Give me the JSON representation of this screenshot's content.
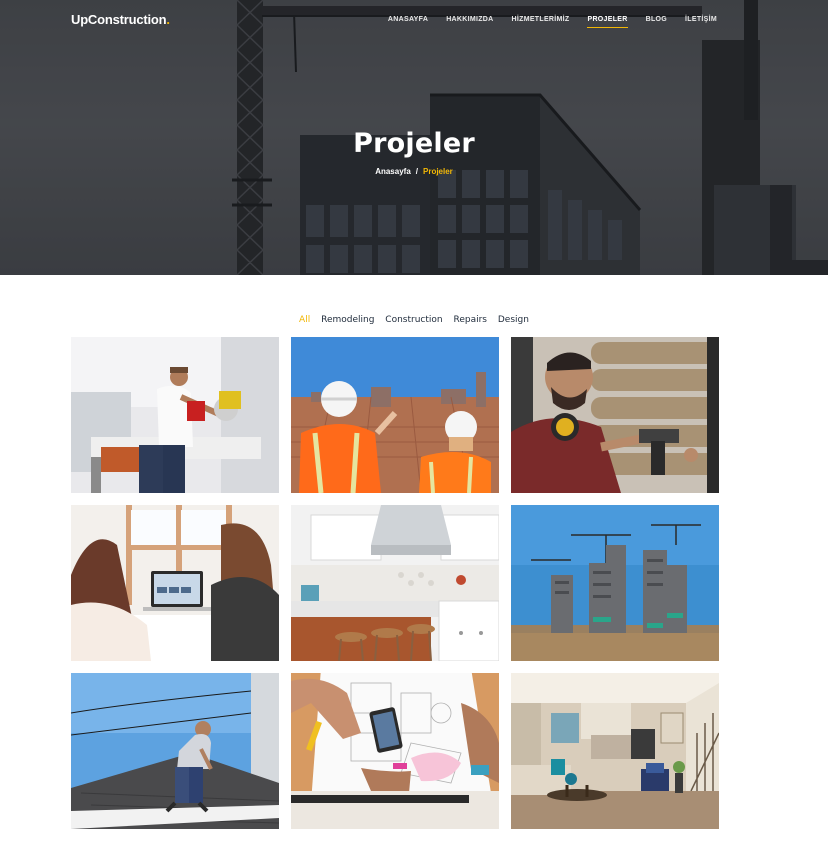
{
  "brand": {
    "name": "UpConstruction",
    "dot": "."
  },
  "nav": {
    "items": [
      {
        "label": "ANASAYFA",
        "active": false
      },
      {
        "label": "HAKKIMIZDA",
        "active": false
      },
      {
        "label": "HİZMETLERİMİZ",
        "active": false
      },
      {
        "label": "PROJELER",
        "active": true
      },
      {
        "label": "BLOG",
        "active": false
      },
      {
        "label": "İLETİŞİM",
        "active": false
      }
    ]
  },
  "hero": {
    "title": "Projeler",
    "breadcrumb": {
      "home": "Anasayfa",
      "separator": "/",
      "current": "Projeler"
    }
  },
  "filters": {
    "items": [
      {
        "label": "All",
        "active": true
      },
      {
        "label": "Remodeling",
        "active": false
      },
      {
        "label": "Construction",
        "active": false
      },
      {
        "label": "Repairs",
        "active": false
      },
      {
        "label": "Design",
        "active": false
      }
    ]
  },
  "colors": {
    "accent": "#f2b705",
    "text_dark": "#1e2a3a"
  },
  "projects": [
    {
      "icon": "worker-saw-photo"
    },
    {
      "icon": "engineers-hardhat-photo"
    },
    {
      "icon": "carpenter-drill-photo"
    },
    {
      "icon": "office-laptop-photo"
    },
    {
      "icon": "kitchen-interior-photo"
    },
    {
      "icon": "towers-construction-photo"
    },
    {
      "icon": "roofer-photo"
    },
    {
      "icon": "blueprint-desk-photo"
    },
    {
      "icon": "living-room-photo"
    }
  ]
}
